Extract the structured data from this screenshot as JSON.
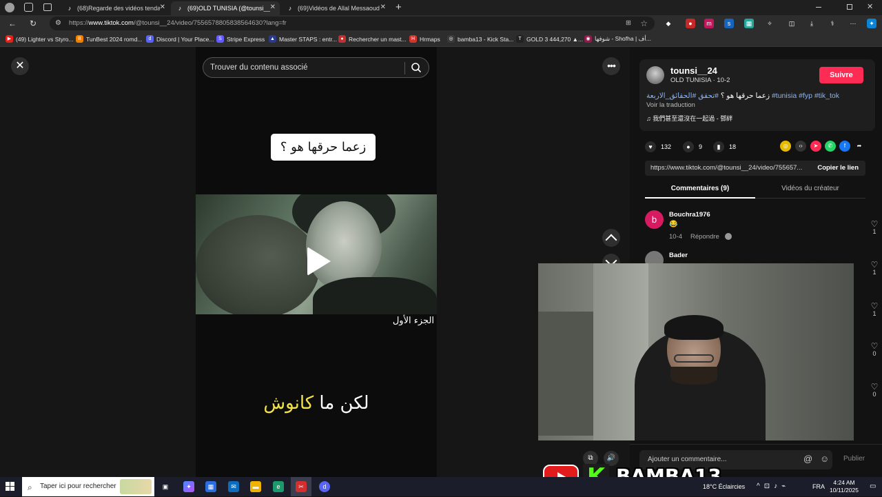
{
  "browser": {
    "tabs": [
      {
        "label": "(68)Regarde des vidéos tendance",
        "active": false
      },
      {
        "label": "(69)OLD TUNISIA (@tounsi__24)",
        "active": true
      },
      {
        "label": "(69)Vidéos de Allal Messaoud (@",
        "active": false
      }
    ],
    "new_tab_label": "+",
    "url_host": "www.tiktok.com",
    "url_prefix": "https://",
    "url_path": "/@tounsi__24/video/7556578805838564630?lang=fr",
    "bookmarks": [
      {
        "label": "(49) Lighter vs Styro...",
        "icon": "youtube-icon",
        "color": "#e62117"
      },
      {
        "label": "TunBest 2024 romd...",
        "icon": "blogger-icon",
        "color": "#f57d00"
      },
      {
        "label": "Discord | Your Place...",
        "icon": "discord-icon",
        "color": "#5865f2"
      },
      {
        "label": "Stripe Express",
        "icon": "stripe-icon",
        "color": "#635bff"
      },
      {
        "label": "Master STAPS : entr...",
        "icon": "school-icon",
        "color": "#2b3a8c"
      },
      {
        "label": "Rechercher un mast...",
        "icon": "person-icon",
        "color": "#c03030"
      },
      {
        "label": "Hrmaps",
        "icon": "hr-icon",
        "color": "#d0342c"
      },
      {
        "label": "bamba13 - Kick Sta...",
        "icon": "kick-icon",
        "color": "#3a3a3a"
      },
      {
        "label": "GOLD 3 444,270 ▲...",
        "icon": "tv-icon",
        "color": "#222222"
      },
      {
        "label": "شوفها - Shofha | أف...",
        "icon": "shofha-icon",
        "color": "#8e1b4b"
      }
    ]
  },
  "page": {
    "search_placeholder": "Trouver du contenu associé",
    "caption_top": "زعما حرقها هو ؟",
    "caption_part": "الجزء الأول",
    "caption_bottom_white": "لكن ما",
    "caption_bottom_yellow": "كانوش",
    "close_label": "✕",
    "more_label": "•••"
  },
  "author": {
    "username": "tounsi__24",
    "nickname_date": "OLD TUNISIA · 10-2",
    "follow_label": "Suivre",
    "description_text": "زعما حرقها هو ؟",
    "description_tags": "#تحقق #الحقائق_الاربعة #tunisia #fyp #tik_tok",
    "translate_label": "Voir la traduction",
    "music": "♫  我們甚至還沒在一起過 - 鄧絆"
  },
  "stats": {
    "likes": "132",
    "comments": "9",
    "saves": "18"
  },
  "share_link": {
    "url": "https://www.tiktok.com/@tounsi__24/video/755657...",
    "copy_label": "Copier le lien"
  },
  "panel_tabs": {
    "comments": "Commentaires (9)",
    "creator_videos": "Vidéos du créateur"
  },
  "comments": [
    {
      "name": "Bouchra1976",
      "initial": "b",
      "emoji": "😂",
      "date": "10-4",
      "reply": "Répondre",
      "likes": "1"
    },
    {
      "name": "Bader",
      "initial": "",
      "emoji": "",
      "date": "",
      "reply": "",
      "likes": "1"
    }
  ],
  "like_column": [
    "1",
    "0",
    "0"
  ],
  "add_comment": {
    "placeholder": "Ajouter un commentaire...",
    "at": "@",
    "emoji": "☺",
    "publish": "Publier"
  },
  "overlay": {
    "brand_text": "BAMBA13",
    "kick_letter": "K"
  },
  "taskbar": {
    "search_placeholder": "Taper ici pour rechercher",
    "weather": "18°C  Éclaircies",
    "language": "FRA",
    "time": "4:24 AM",
    "date": "10/11/2025"
  }
}
